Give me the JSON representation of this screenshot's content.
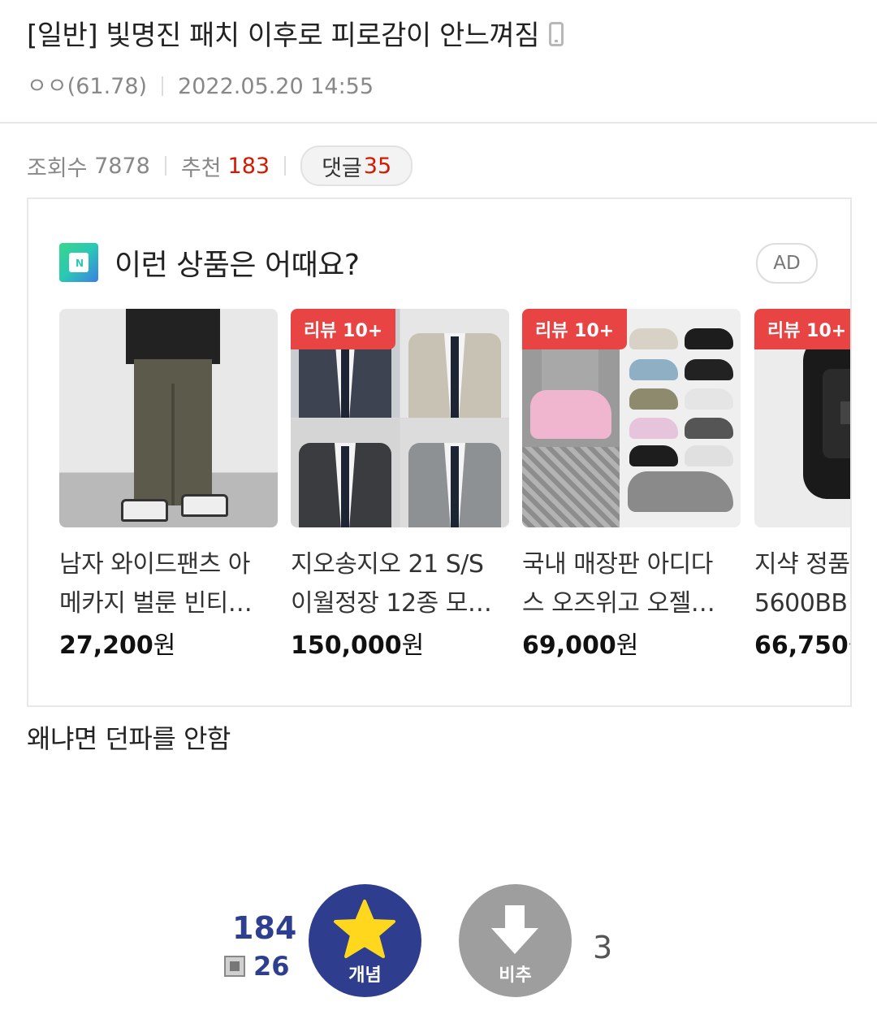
{
  "post": {
    "title": "[일반] 빛명진 패치 이후로 피로감이 안느껴짐",
    "author": "ㅇㅇ(61.78)",
    "date": "2022.05.20 14:55"
  },
  "stats": {
    "views_label": "조회수",
    "views": "7878",
    "recommend_label": "추천",
    "recommend": "183",
    "comment_label": "댓글",
    "comment_count": "35"
  },
  "ad": {
    "title": "이런 상품은 어때요?",
    "badge": "AD",
    "products": [
      {
        "name1": "남자 와이드팬츠 아",
        "name2": "메카지 벌룬 빈티…",
        "price": "27,200",
        "currency": "원",
        "review": ""
      },
      {
        "name1": "지오송지오 21 S/S",
        "name2": "이월정장 12종 모…",
        "price": "150,000",
        "currency": "원",
        "review": "리뷰 10+"
      },
      {
        "name1": "국내 매장판 아디다",
        "name2": "스 오즈위고 오젤…",
        "price": "69,000",
        "currency": "원",
        "review": "리뷰 10+"
      },
      {
        "name1": "지샥 정품",
        "name2": "5600BB",
        "price": "66,750",
        "currency": "원",
        "review": "리뷰 10+"
      }
    ]
  },
  "body": {
    "text": "왜냐면 던파를 안함"
  },
  "vote": {
    "up_count": "184",
    "fix_count": "26",
    "up_label": "개념",
    "down_label": "비추",
    "down_count": "3"
  },
  "colors": {
    "accent_red": "#d31900",
    "vote_blue": "#2f3d8e",
    "vote_gray": "#9e9e9e",
    "star_yellow": "#ffd81e"
  }
}
